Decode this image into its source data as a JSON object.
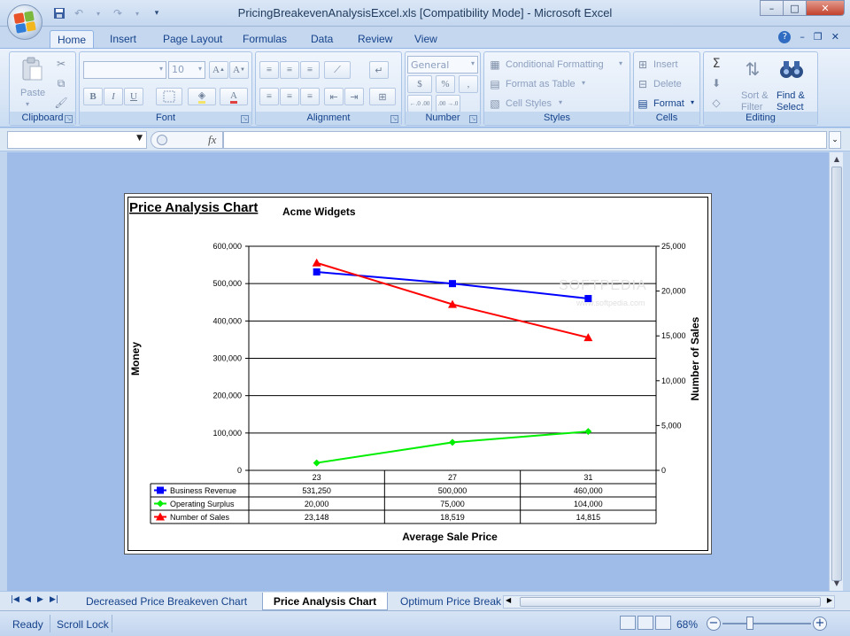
{
  "window": {
    "title": "PricingBreakevenAnalysisExcel.xls  [Compatibility Mode] - Microsoft Excel",
    "controls": {
      "minimize": "–",
      "maximize": "□",
      "close": "✕"
    }
  },
  "ribbon_tabs": [
    "Home",
    "Insert",
    "Page Layout",
    "Formulas",
    "Data",
    "Review",
    "View"
  ],
  "active_tab": "Home",
  "ribbon": {
    "clipboard": {
      "label": "Clipboard",
      "paste": "Paste"
    },
    "font": {
      "label": "Font",
      "font_name": "",
      "font_size": "10",
      "bold": "B",
      "italic": "I",
      "underline": "U"
    },
    "alignment": {
      "label": "Alignment"
    },
    "number": {
      "label": "Number",
      "format": "General",
      "currency": "$",
      "percent": "%",
      "comma": ",",
      "inc_decimal": "←.0 .00",
      "dec_decimal": ".00 →.0"
    },
    "styles": {
      "label": "Styles",
      "conditional": "Conditional Formatting",
      "format_table": "Format as Table",
      "cell_styles": "Cell Styles"
    },
    "cells": {
      "label": "Cells",
      "insert": "Insert",
      "delete": "Delete",
      "format": "Format"
    },
    "editing": {
      "label": "Editing",
      "sort_line1": "Sort &",
      "sort_line2": "Filter",
      "find_line1": "Find &",
      "find_line2": "Select"
    }
  },
  "formula_bar": {
    "name_box": "",
    "fx": "fx",
    "content": ""
  },
  "chart": {
    "heading": "Price Analysis Chart",
    "subtitle": "Acme Widgets",
    "watermark": "SOFTPEDIA",
    "watermark_url": "www.softpedia.com",
    "primary_ticks": [
      "600,000",
      "500,000",
      "400,000",
      "300,000",
      "200,000",
      "100,000",
      "0"
    ],
    "secondary_ticks": [
      "25,000",
      "20,000",
      "15,000",
      "10,000",
      "5,000",
      "0"
    ],
    "table_header": [
      "23",
      "27",
      "31"
    ],
    "table_rows": [
      {
        "name": "Business Revenue",
        "cells": [
          "531,250",
          "500,000",
          "460,000"
        ]
      },
      {
        "name": "Operating Surplus",
        "cells": [
          "20,000",
          "75,000",
          "104,000"
        ]
      },
      {
        "name": "Number of Sales",
        "cells": [
          "23,148",
          "18,519",
          "14,815"
        ]
      }
    ]
  },
  "chart_data": {
    "type": "line",
    "title": "Price Analysis Chart",
    "subtitle": "Acme Widgets",
    "xlabel": "Average Sale Price",
    "ylabel": "Money",
    "y2label": "Number of Sales",
    "categories": [
      "23",
      "27",
      "31"
    ],
    "ylim": [
      0,
      600000
    ],
    "y2lim": [
      0,
      25000
    ],
    "grid": true,
    "legend": "data-table",
    "series": [
      {
        "name": "Business Revenue",
        "values": [
          531250,
          500000,
          460000
        ],
        "axis": "primary",
        "color": "#0000ff",
        "marker": "square"
      },
      {
        "name": "Operating Surplus",
        "values": [
          20000,
          75000,
          104000
        ],
        "axis": "primary",
        "color": "#00ee00",
        "marker": "diamond"
      },
      {
        "name": "Number of Sales",
        "values": [
          23148,
          18519,
          14815
        ],
        "axis": "secondary",
        "color": "#ff0000",
        "marker": "triangle"
      }
    ]
  },
  "sheet_tabs": [
    "Decreased Price Breakeven Chart",
    "Price Analysis Chart",
    "Optimum Price Break"
  ],
  "active_sheet": "Price Analysis Chart",
  "status": {
    "ready": "Ready",
    "scroll_lock": "Scroll Lock",
    "zoom": "68%",
    "zoom_out": "−",
    "zoom_in": "+"
  }
}
